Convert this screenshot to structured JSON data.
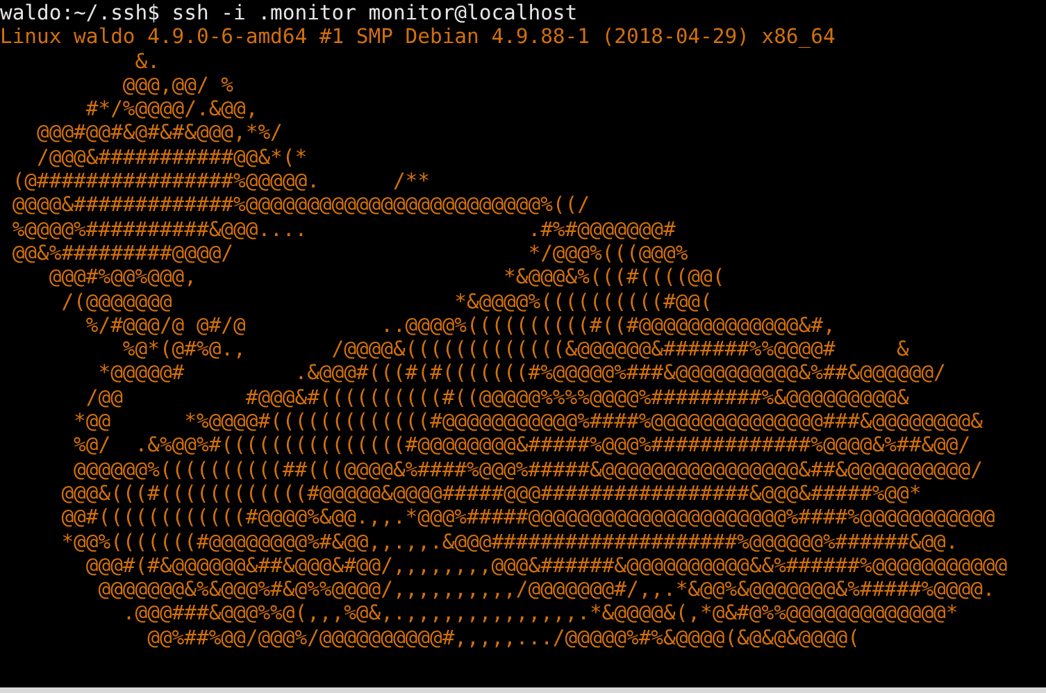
{
  "terminal": {
    "lines": [
      {
        "kind": "prompt",
        "text": "waldo:~/.ssh$ ssh -i .monitor monitor@localhost"
      },
      {
        "kind": "output",
        "text": "Linux waldo 4.9.0-6-amd64 #1 SMP Debian 4.9.88-1 (2018-04-29) x86_64"
      },
      {
        "kind": "output",
        "text": "           &."
      },
      {
        "kind": "output",
        "text": "          @@@,@@/ %"
      },
      {
        "kind": "output",
        "text": "       #*/%@@@@/.&@@,"
      },
      {
        "kind": "output",
        "text": "   @@@#@@#&@#&#&@@@,*%/"
      },
      {
        "kind": "output",
        "text": "   /@@@&###########@@&*(*"
      },
      {
        "kind": "output",
        "text": " (@################%@@@@@.      /**"
      },
      {
        "kind": "output",
        "text": " @@@@&#############%@@@@@@@@@@@@@@@@@@@@@@@@%((/"
      },
      {
        "kind": "output",
        "text": " %@@@@%##########&@@@....                  .#%#@@@@@@@#"
      },
      {
        "kind": "output",
        "text": " @@&%#########@@@@/                        */@@@%(((@@@%"
      },
      {
        "kind": "output",
        "text": "    @@@#%@@%@@@,                         *&@@@&%(((#((((@@("
      },
      {
        "kind": "output",
        "text": "     /(@@@@@@@                       *&@@@@%((((((((((#@@("
      },
      {
        "kind": "output",
        "text": "       %/#@@@/@ @#/@           ..@@@@%((((((((((#((#@@@@@@@@@@@@@&#,"
      },
      {
        "kind": "output",
        "text": "          %@*(@#%@.,       /@@@@&(((((((((((((&@@@@@@&#######%%@@@@#     &"
      },
      {
        "kind": "output",
        "text": "        *@@@@@#         .&@@@#(((#(#(((((((#%@@@@@%###&@@@@@@@@@@&%##&@@@@@@/"
      },
      {
        "kind": "output",
        "text": "       /@@          #@@@&#((((((((((#((@@@@@%%%%@@@@%#########%&@@@@@@@@@&"
      },
      {
        "kind": "output",
        "text": "      *@@      *%@@@@#(((((((((((((#@@@@@@@@@@@%####%@@@@@@@@@@@@@@###&@@@@@@@@&"
      },
      {
        "kind": "output",
        "text": "      %@/  .&%@@%#(((((((((((((((#@@@@@@@@&#####%@@@%#############%@@@@&%##&@@/"
      },
      {
        "kind": "output",
        "text": "      @@@@@@%((((((((((##(((@@@@&%####%@@@%#####&@@@@@@@@@@@@@@@@&##&@@@@@@@@@@/"
      },
      {
        "kind": "output",
        "text": "     @@@&(((#((((((((((((#@@@@@&@@@@#####@@@#################&@@@&#####%@@*"
      },
      {
        "kind": "output",
        "text": "     @@#((((((((((((#@@@@%&@@.,,.*@@@%#####@@@@@@@@@@@@@@@@@@@@@%####%@@@@@@@@@@@"
      },
      {
        "kind": "output",
        "text": "     *@@%(((((((#@@@@@@@@%#&@@,,.,,.&@@@####################%@@@@@@%######&@@."
      },
      {
        "kind": "output",
        "text": "       @@@#(#&@@@@@@&##&@@@&#@@/,,,,,,,,@@@&######&@@@@@@@@@@&&%######%@@@@@@@@@@@"
      },
      {
        "kind": "output",
        "text": "        @@@@@@@&%&@@@%#&@%%@@@@/,,,,,,,,,,/@@@@@@@#/,,.*&@@%&@@@@@@@&%#####%@@@@."
      },
      {
        "kind": "output",
        "text": "          .@@@###&@@@%%@(,,,%@&,.,,,,,,,,,,,,,,.*&@@@@&(,*@&#@%%@@@@@@@@@@@@@*"
      },
      {
        "kind": "output",
        "text": "            @@%##%@@/@@@%/@@@@@@@@@@#,,,,,.../@@@@@%#%&@@@@(&@&@&@@@@("
      }
    ]
  }
}
